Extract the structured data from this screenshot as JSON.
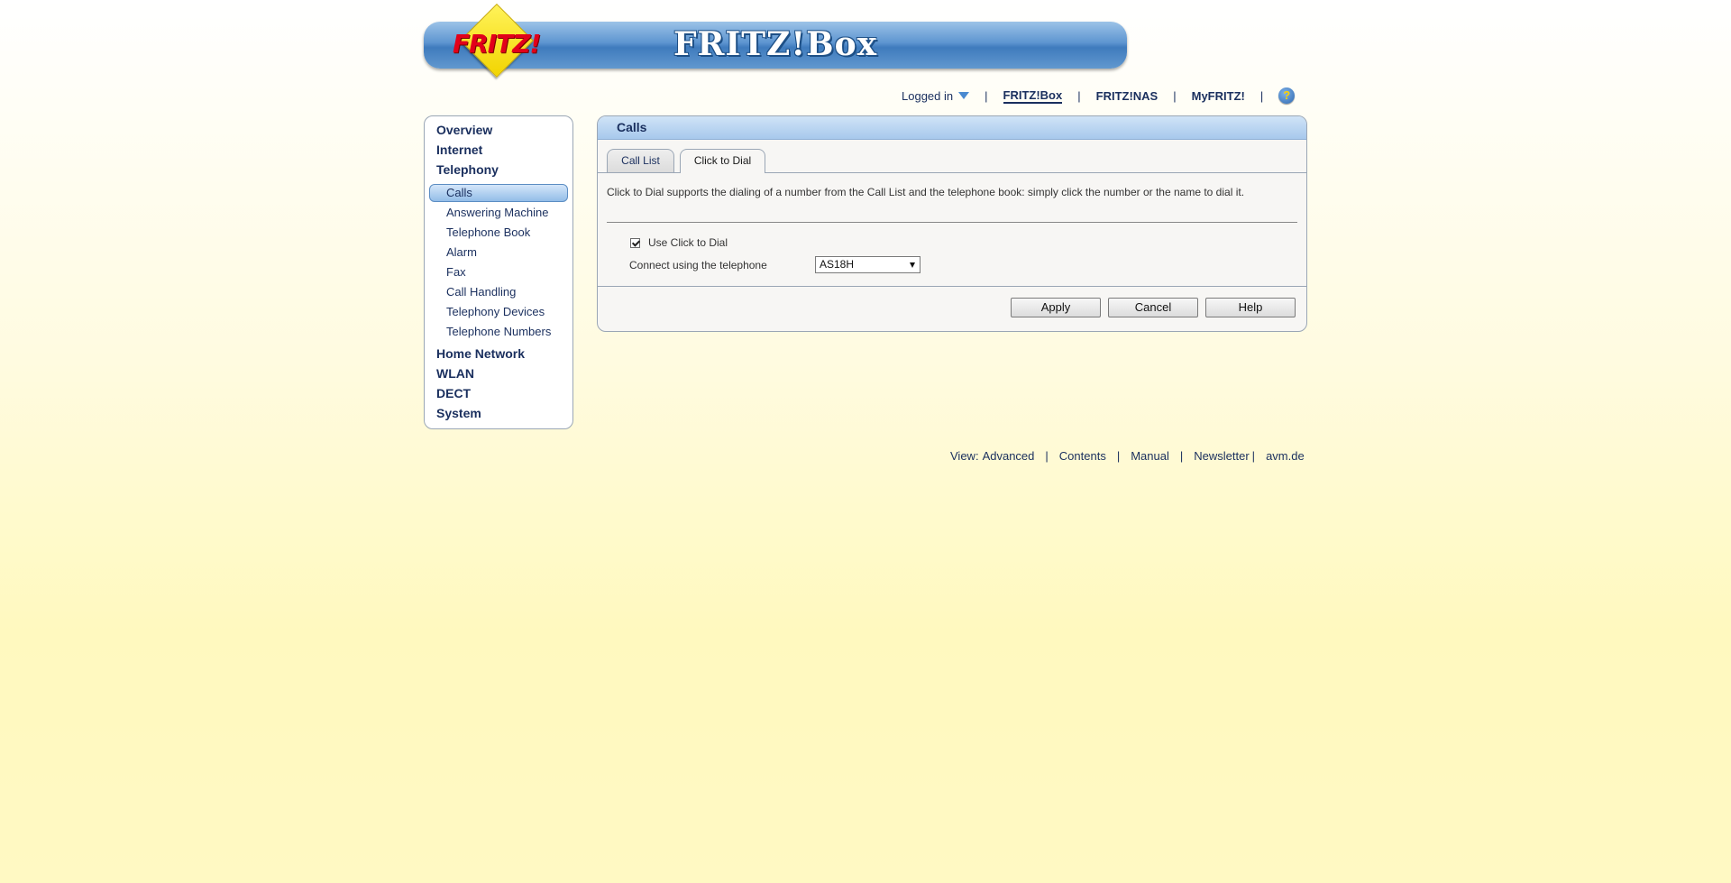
{
  "header": {
    "logo_text": "FRITZ!",
    "title": "FRITZ!Box"
  },
  "topnav": {
    "login_label": "Logged in",
    "links": [
      "FRITZ!Box",
      "FRITZ!NAS",
      "MyFRITZ!"
    ],
    "help_icon": "?"
  },
  "sidebar": {
    "main": [
      "Overview",
      "Internet",
      "Telephony",
      "Home Network",
      "WLAN",
      "DECT",
      "System"
    ],
    "telephony_sub": [
      "Calls",
      "Answering Machine",
      "Telephone Book",
      "Alarm",
      "Fax",
      "Call Handling",
      "Telephony Devices",
      "Telephone Numbers"
    ],
    "active_sub": "Calls"
  },
  "panel": {
    "title": "Calls",
    "tabs": [
      "Call List",
      "Click to Dial"
    ],
    "active_tab": "Click to Dial",
    "description": "Click to Dial supports the dialing of a number from the Call List and the telephone book: simply click the number or the name to dial it.",
    "checkbox_label": "Use Click to Dial",
    "checkbox_checked": true,
    "connect_label": "Connect using the telephone",
    "select_value": "AS18H",
    "buttons": [
      "Apply",
      "Cancel",
      "Help"
    ]
  },
  "footer": {
    "view_prefix": "View:",
    "view_value": "Advanced",
    "links": [
      "Contents",
      "Manual",
      "Newsletter",
      "avm.de"
    ]
  },
  "colors": {
    "nav_text": "#1a2f5e",
    "banner_blue": "#4a86c6",
    "background_yellow": "#fff9c3",
    "logo_red": "#e2001a",
    "logo_yellow": "#f7e21a"
  }
}
